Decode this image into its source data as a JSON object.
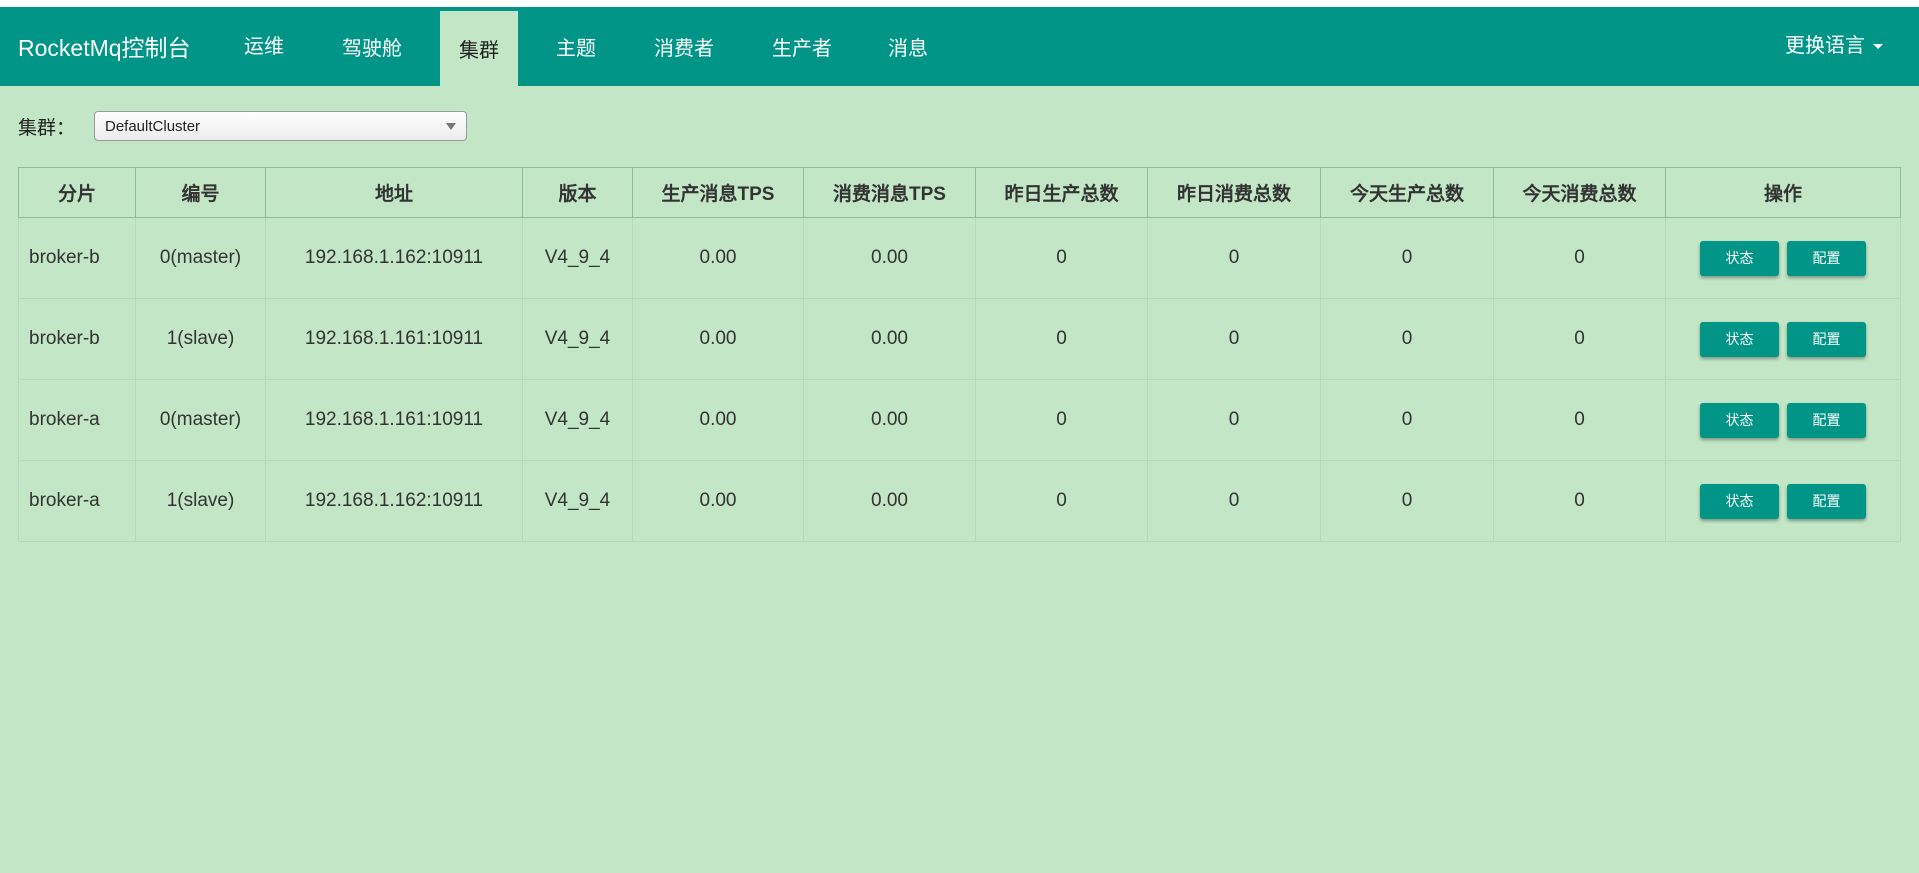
{
  "brand": "RocketMq控制台",
  "nav": [
    {
      "label": "运维",
      "active": false
    },
    {
      "label": "驾驶舱",
      "active": false
    },
    {
      "label": "集群",
      "active": true
    },
    {
      "label": "主题",
      "active": false
    },
    {
      "label": "消费者",
      "active": false
    },
    {
      "label": "生产者",
      "active": false
    },
    {
      "label": "消息",
      "active": false
    }
  ],
  "language_label": "更换语言",
  "filter": {
    "label": "集群：",
    "selected": "DefaultCluster"
  },
  "table": {
    "headers": [
      "分片",
      "编号",
      "地址",
      "版本",
      "生产消息TPS",
      "消费消息TPS",
      "昨日生产总数",
      "昨日消费总数",
      "今天生产总数",
      "今天消费总数",
      "操作"
    ],
    "rows": [
      {
        "shard": "broker-b",
        "id": "0(master)",
        "address": "192.168.1.162:10911",
        "version": "V4_9_4",
        "produce_tps": "0.00",
        "consume_tps": "0.00",
        "yesterday_produce": "0",
        "yesterday_consume": "0",
        "today_produce": "0",
        "today_consume": "0"
      },
      {
        "shard": "broker-b",
        "id": "1(slave)",
        "address": "192.168.1.161:10911",
        "version": "V4_9_4",
        "produce_tps": "0.00",
        "consume_tps": "0.00",
        "yesterday_produce": "0",
        "yesterday_consume": "0",
        "today_produce": "0",
        "today_consume": "0"
      },
      {
        "shard": "broker-a",
        "id": "0(master)",
        "address": "192.168.1.161:10911",
        "version": "V4_9_4",
        "produce_tps": "0.00",
        "consume_tps": "0.00",
        "yesterday_produce": "0",
        "yesterday_consume": "0",
        "today_produce": "0",
        "today_consume": "0"
      },
      {
        "shard": "broker-a",
        "id": "1(slave)",
        "address": "192.168.1.162:10911",
        "version": "V4_9_4",
        "produce_tps": "0.00",
        "consume_tps": "0.00",
        "yesterday_produce": "0",
        "yesterday_consume": "0",
        "today_produce": "0",
        "today_consume": "0"
      }
    ],
    "actions": {
      "status": "状态",
      "config": "配置"
    }
  },
  "colors": {
    "navbar": "#009587",
    "background": "#c2e6c6",
    "button": "#009587"
  },
  "icons": {
    "language_dropdown": "caret-down-icon",
    "select_dropdown": "triangle-down-icon"
  }
}
